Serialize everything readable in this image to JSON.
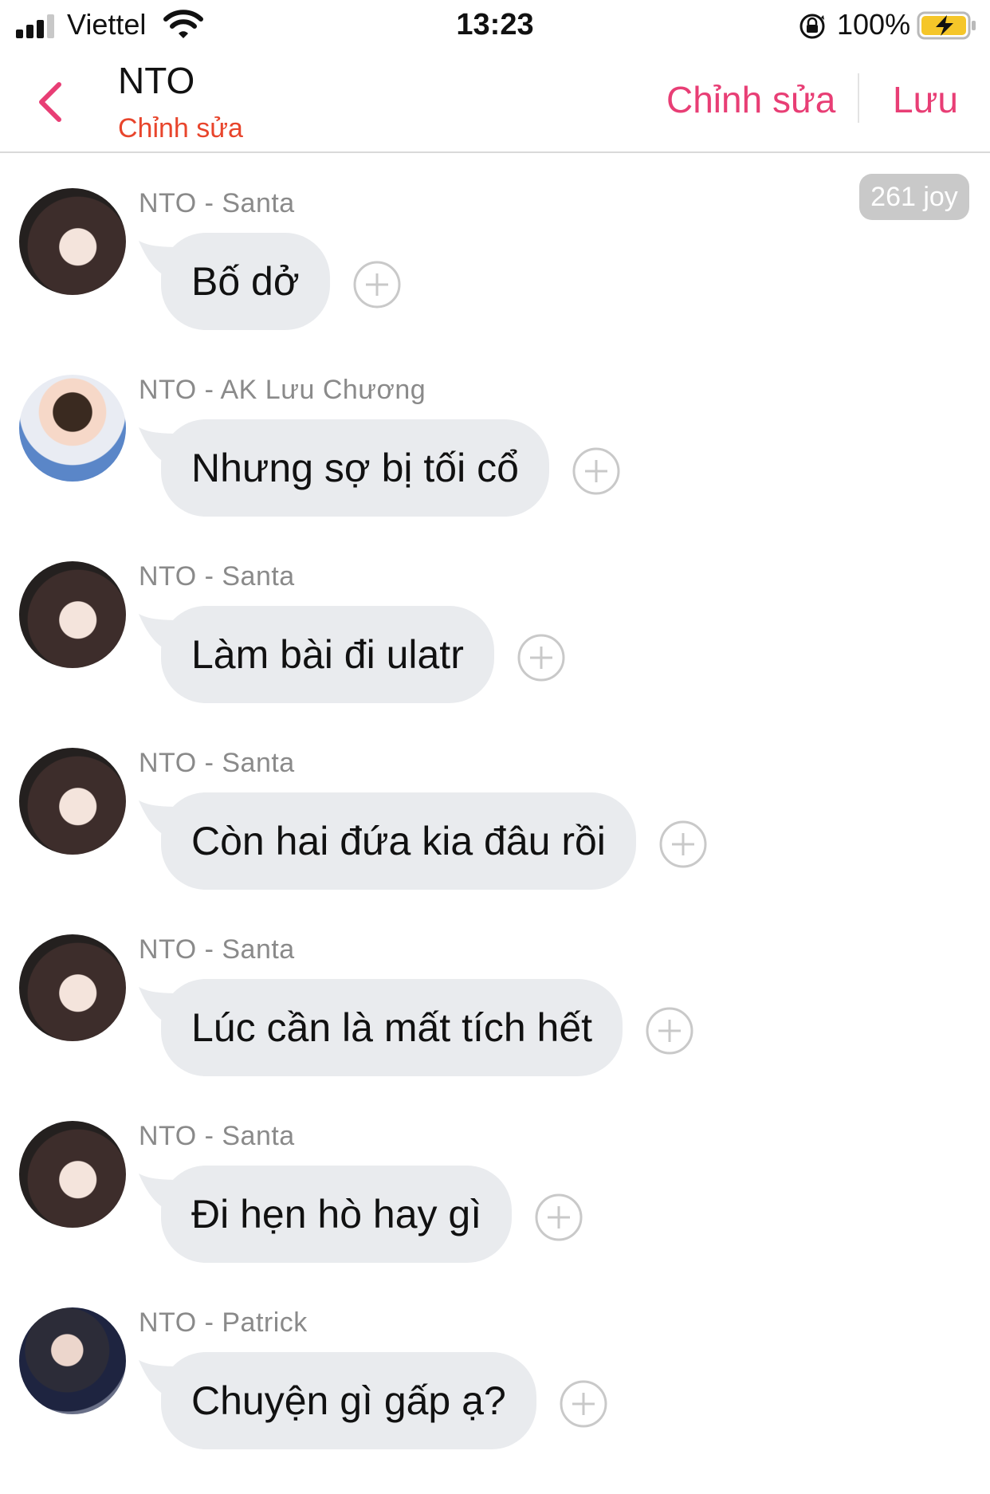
{
  "status_bar": {
    "carrier": "Viettel",
    "time": "13:23",
    "battery_percent": "100%",
    "icons": [
      "signal-bars-icon",
      "wifi-icon",
      "orientation-lock-icon",
      "battery-charging-icon"
    ]
  },
  "nav": {
    "title": "NTO",
    "subtitle": "Chỉnh sửa",
    "edit_label": "Chỉnh sửa",
    "save_label": "Lưu",
    "accent_color": "#e83e75",
    "subtitle_color": "#e8452c"
  },
  "joy_badge": "261 joy",
  "messages": [
    {
      "sender": "NTO - Santa",
      "text": "Bố dở",
      "avatar": "santa"
    },
    {
      "sender": "NTO - AK Lưu Chương",
      "text": "Nhưng sợ bị tối cổ",
      "avatar": "ak"
    },
    {
      "sender": "NTO - Santa",
      "text": "Làm bài đi ulatr",
      "avatar": "santa"
    },
    {
      "sender": "NTO - Santa",
      "text": "Còn hai đứa kia đâu rồi",
      "avatar": "santa"
    },
    {
      "sender": "NTO - Santa",
      "text": "Lúc cần là mất tích hết",
      "avatar": "santa"
    },
    {
      "sender": "NTO - Santa",
      "text": "Đi hẹn hò hay gì",
      "avatar": "santa"
    },
    {
      "sender": "NTO - Patrick",
      "text": "Chuyện gì gấp ạ?",
      "avatar": "patrick"
    }
  ]
}
